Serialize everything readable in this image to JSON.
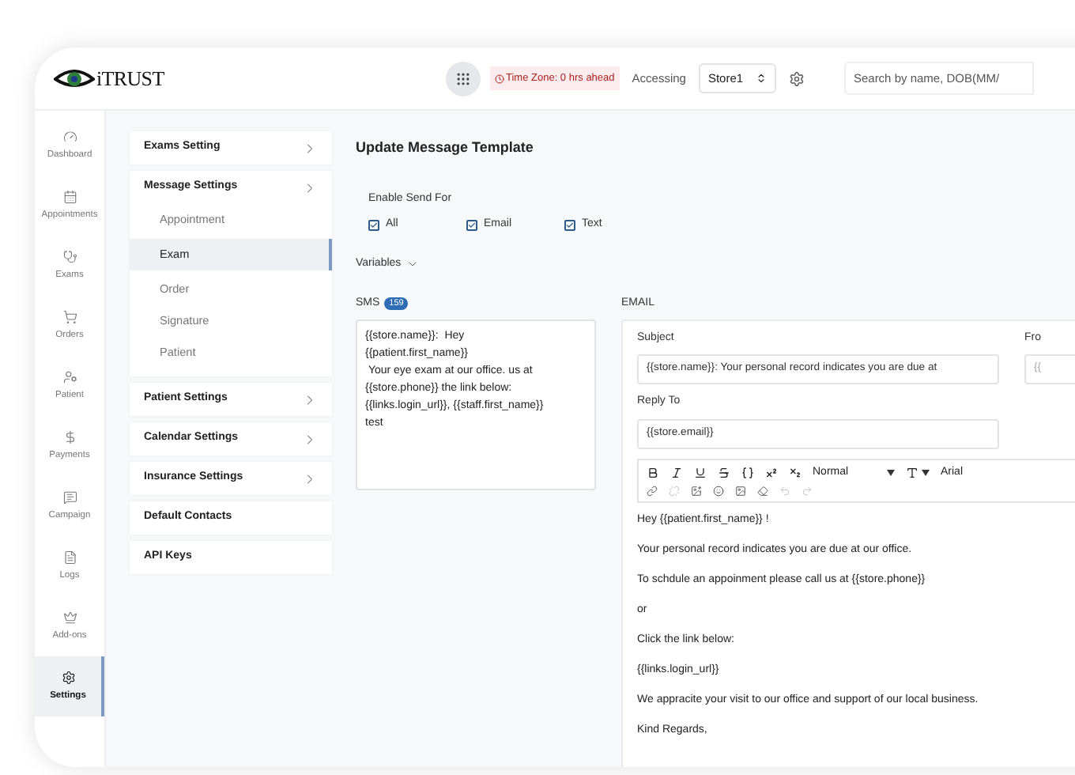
{
  "header": {
    "logo_text": "iTRUST",
    "time_zone": "Time Zone: 0 hrs ahead",
    "accessing_label": "Accessing",
    "store_select": "Store1",
    "search": {
      "placeholder": "Search by name, DOB(MM/"
    }
  },
  "sidebar": {
    "items": [
      {
        "label": "Dashboard",
        "selected": false
      },
      {
        "label": "Appointments",
        "selected": false
      },
      {
        "label": "Exams",
        "selected": false
      },
      {
        "label": "Orders",
        "selected": false
      },
      {
        "label": "Patient",
        "selected": false
      },
      {
        "label": "Payments",
        "selected": false
      },
      {
        "label": "Campaign",
        "selected": false
      },
      {
        "label": "Logs",
        "selected": false
      },
      {
        "label": "Add-ons",
        "selected": false
      },
      {
        "label": "Settings",
        "selected": true
      }
    ]
  },
  "settings_menu": [
    {
      "label": "Exams Setting",
      "has_chevron": true
    },
    {
      "label": "Message Settings",
      "has_chevron": true,
      "children": [
        {
          "label": "Appointment",
          "selected": false
        },
        {
          "label": "Exam",
          "selected": true
        },
        {
          "label": "Order",
          "selected": false
        },
        {
          "label": "Signature",
          "selected": false
        },
        {
          "label": "Patient",
          "selected": false
        }
      ]
    },
    {
      "label": "Patient Settings",
      "has_chevron": true
    },
    {
      "label": "Calendar Settings",
      "has_chevron": true
    },
    {
      "label": "Insurance Settings",
      "has_chevron": true
    },
    {
      "label": "Default Contacts",
      "has_chevron": false
    },
    {
      "label": "API Keys",
      "has_chevron": false
    }
  ],
  "page_title": "Update Message Template",
  "enable_send_for": {
    "label": "Enable Send For",
    "options": [
      {
        "label": "All",
        "checked": true
      },
      {
        "label": "Email",
        "checked": true
      },
      {
        "label": "Text",
        "checked": true
      }
    ]
  },
  "variables": {
    "label": "Variables",
    "expanded": false
  },
  "sms": {
    "label": "SMS",
    "count": "159",
    "text": "{{store.name}}:  Hey\n{{patient.first_name}}\n Your eye exam at our office. us at\n{{store.phone}} the link below:\n{{links.login_url}}, {{staff.first_name}}\ntest"
  },
  "email": {
    "label": "EMAIL",
    "subject_label": "Subject",
    "subject": "{{store.name}}: Your personal record indicates you are due at",
    "from_label": "Fro",
    "from_value": "{{",
    "reply_to_label": "Reply To",
    "reply_to": "{{store.email}}",
    "format_select": "Normal",
    "font_select": "Arial",
    "body": [
      "Hey {{patient.first_name}} !",
      "Your personal record indicates you are due at our office.",
      "To schdule an appoinment please call us at {{store.phone}}",
      "or",
      "Click the link below:",
      "{{links.login_url}}",
      "We appracite your visit to our office and support of our local business.",
      "Kind Regards,"
    ]
  }
}
